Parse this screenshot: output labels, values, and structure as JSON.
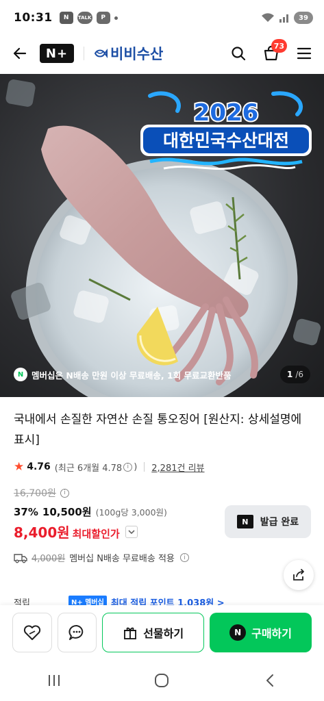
{
  "status_bar": {
    "time": "10:31",
    "chip_naver": "N",
    "chip_talk": "TALK",
    "chip_p": "P",
    "battery": "39"
  },
  "header": {
    "nplus": "N+",
    "brand": "비비수산",
    "cart_count": "73",
    "icons": [
      "back-arrow-icon",
      "search-icon",
      "cart-icon",
      "menu-icon"
    ]
  },
  "hero": {
    "event_year": "2026",
    "event_title": "대한민국수산대전",
    "promo_text": "멤버십은 N배송 만원 이상 무료배송, 1회 무료교환반품",
    "pager_current": "1",
    "pager_sep": "/",
    "pager_total": "6"
  },
  "product": {
    "title": "국내에서 손질한 자연산 손질 통오징어 [원산지: 상세설명에 표시]",
    "rating": "4.76",
    "rating_recent": "(최근 6개월 4.78",
    "rating_recent_end": ")",
    "review_count": "2,281건 리뷰",
    "original_price": "16,700원",
    "discount_pct": "37%",
    "discount_price": "10,500원",
    "unit_price": "(100g당 3,000원)",
    "max_price": "8,400원",
    "max_label": "최대할인가",
    "shipping_orig": "4,000원",
    "shipping_text": "멤버십 N배송 무료배송 적용",
    "points_label": "적립",
    "points_badge": "N+ 멤버십",
    "points_text": "최대 적립 포인트 1,038원 >"
  },
  "coupon": {
    "label": "발급 완료"
  },
  "actions": {
    "gift_label": "선물하기",
    "buy_label": "구매하기"
  },
  "colors": {
    "naver_green": "#03c75a",
    "sale_red": "#ea1d2c",
    "brand_blue": "#1d4fa5",
    "badge_red": "#ff3b30"
  }
}
